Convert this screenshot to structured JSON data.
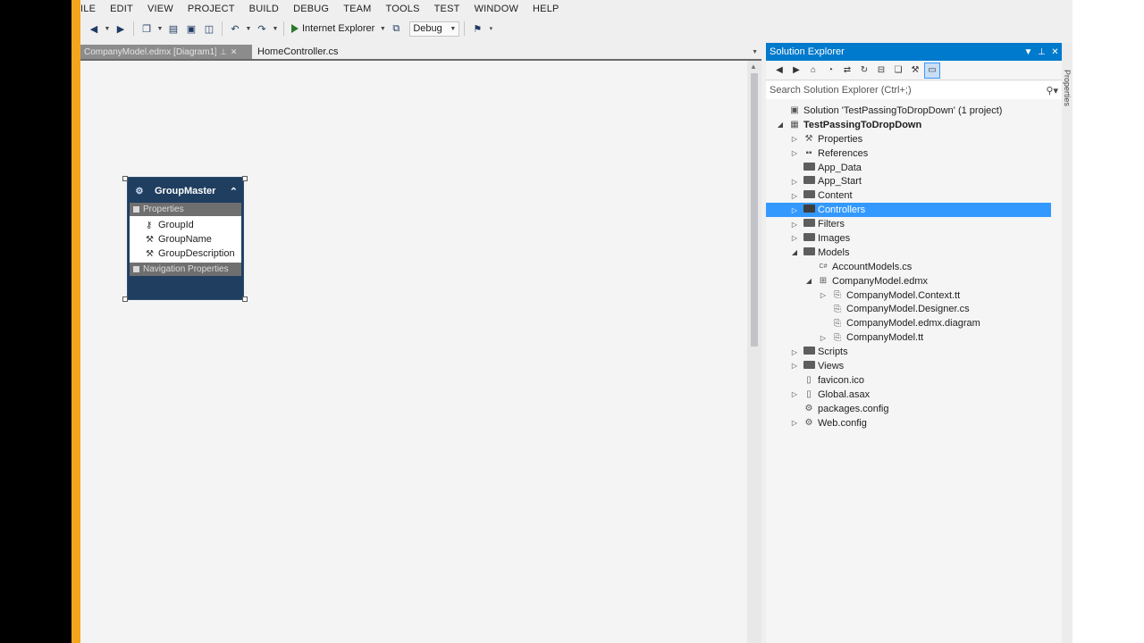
{
  "menu": [
    "ILE",
    "EDIT",
    "VIEW",
    "PROJECT",
    "BUILD",
    "DEBUG",
    "TEAM",
    "TOOLS",
    "TEST",
    "WINDOW",
    "HELP"
  ],
  "toolbar": {
    "run_target": "Internet Explorer",
    "configuration": "Debug",
    "icons": [
      "back-icon",
      "forward-icon",
      "new-project-icon",
      "save-icon",
      "save-all-icon",
      "undo-icon",
      "redo-icon",
      "run-icon",
      "attach-icon"
    ]
  },
  "tabs": {
    "inactive": "CompanyModel.edmx [Diagram1]",
    "active": "HomeController.cs"
  },
  "entity": {
    "title": "GroupMaster",
    "properties_header": "Properties",
    "properties": [
      "GroupId",
      "GroupName",
      "GroupDescription"
    ],
    "navigation_header": "Navigation Properties"
  },
  "solution_explorer": {
    "title": "Solution Explorer",
    "search_placeholder": "Search Solution Explorer (Ctrl+;)",
    "tree": [
      {
        "label": "Solution 'TestPassingToDropDown' (1 project)",
        "level": 0,
        "expander": "",
        "icon": "solution-icon",
        "bold": false
      },
      {
        "label": "TestPassingToDropDown",
        "level": 0,
        "expander": "◢",
        "icon": "project-icon",
        "bold": true
      },
      {
        "label": "Properties",
        "level": 1,
        "expander": "▷",
        "icon": "wrench-icon"
      },
      {
        "label": "References",
        "level": 1,
        "expander": "▷",
        "icon": "references-icon"
      },
      {
        "label": "App_Data",
        "level": 1,
        "expander": "",
        "icon": "folder-icon"
      },
      {
        "label": "App_Start",
        "level": 1,
        "expander": "▷",
        "icon": "folder-icon"
      },
      {
        "label": "Content",
        "level": 1,
        "expander": "▷",
        "icon": "folder-icon"
      },
      {
        "label": "Controllers",
        "level": 1,
        "expander": "▷",
        "icon": "folder-icon",
        "selected": true
      },
      {
        "label": "Filters",
        "level": 1,
        "expander": "▷",
        "icon": "folder-icon"
      },
      {
        "label": "Images",
        "level": 1,
        "expander": "▷",
        "icon": "folder-icon"
      },
      {
        "label": "Models",
        "level": 1,
        "expander": "◢",
        "icon": "folder-icon"
      },
      {
        "label": "AccountModels.cs",
        "level": 2,
        "expander": "",
        "icon": "csharp-file-icon"
      },
      {
        "label": "CompanyModel.edmx",
        "level": 2,
        "expander": "◢",
        "icon": "edmx-icon"
      },
      {
        "label": "CompanyModel.Context.tt",
        "level": 3,
        "expander": "▷",
        "icon": "template-file-icon"
      },
      {
        "label": "CompanyModel.Designer.cs",
        "level": 3,
        "expander": "",
        "icon": "template-file-icon"
      },
      {
        "label": "CompanyModel.edmx.diagram",
        "level": 3,
        "expander": "",
        "icon": "template-file-icon"
      },
      {
        "label": "CompanyModel.tt",
        "level": 3,
        "expander": "▷",
        "icon": "template-file-icon"
      },
      {
        "label": "Scripts",
        "level": 1,
        "expander": "▷",
        "icon": "folder-icon"
      },
      {
        "label": "Views",
        "level": 1,
        "expander": "▷",
        "icon": "folder-icon"
      },
      {
        "label": "favicon.ico",
        "level": 1,
        "expander": "",
        "icon": "file-icon"
      },
      {
        "label": "Global.asax",
        "level": 1,
        "expander": "▷",
        "icon": "file-icon"
      },
      {
        "label": "packages.config",
        "level": 1,
        "expander": "",
        "icon": "config-file-icon"
      },
      {
        "label": "Web.config",
        "level": 1,
        "expander": "▷",
        "icon": "config-file-icon"
      }
    ]
  },
  "properties_panel_label": "Properties",
  "colors": {
    "accent": "#007acc",
    "selection": "#3399ff",
    "entity_header": "#1f3e60",
    "yellow_border": "#f3a51d"
  }
}
